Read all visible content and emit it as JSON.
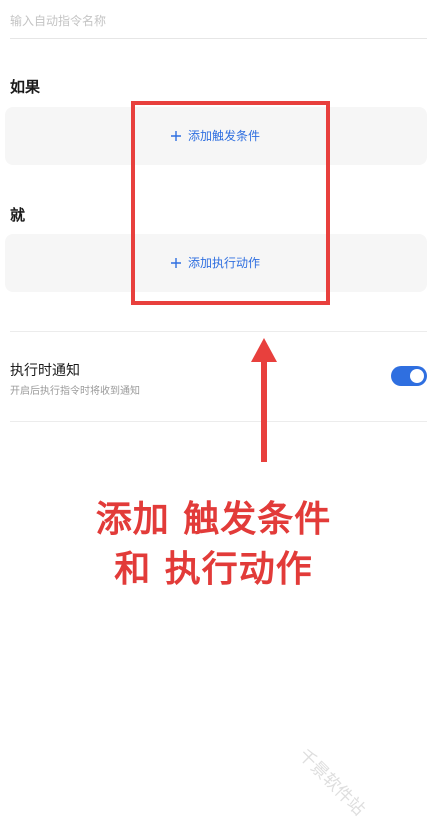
{
  "command_name": {
    "value": "",
    "placeholder": "输入自动指令名称"
  },
  "if_section": {
    "title": "如果",
    "add_label": "添加触发条件"
  },
  "then_section": {
    "title": "就",
    "add_label": "添加执行动作"
  },
  "notify": {
    "title": "执行时通知",
    "subtitle": "开启后执行指令时将收到通知",
    "enabled": true
  },
  "annotation": {
    "line1": "添加 触发条件",
    "line2": "和 执行动作"
  },
  "watermark": "千景软件站",
  "colors": {
    "accent": "#2f6fe0",
    "annotation_red": "#e23b39"
  }
}
